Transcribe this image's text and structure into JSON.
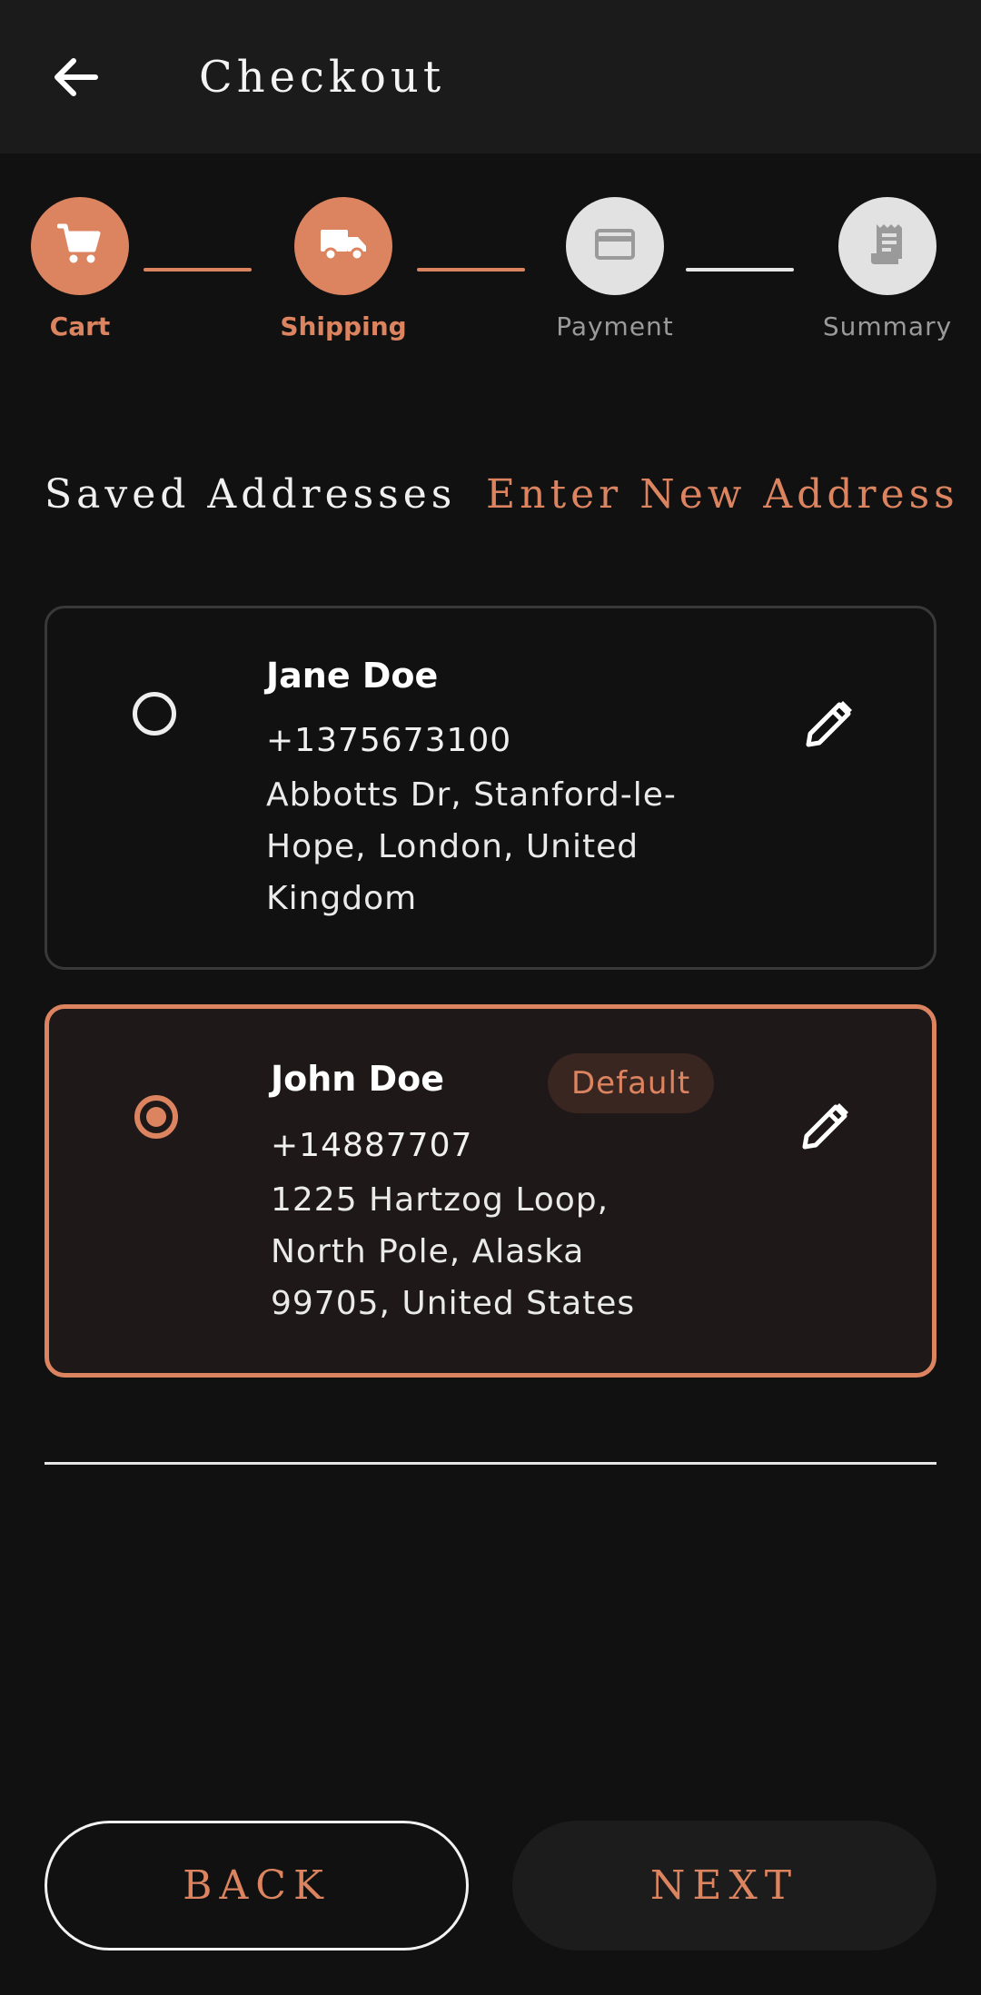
{
  "appbar": {
    "title": "Checkout",
    "back_icon": "arrow-left-icon"
  },
  "stepper": {
    "steps": [
      {
        "label": "Cart",
        "icon": "cart-icon",
        "state": "completed"
      },
      {
        "label": "Shipping",
        "icon": "truck-icon",
        "state": "current"
      },
      {
        "label": "Payment",
        "icon": "credit-card-icon",
        "state": "upcoming"
      },
      {
        "label": "Summary",
        "icon": "receipt-icon",
        "state": "upcoming"
      }
    ]
  },
  "tabs": {
    "saved": "Saved Addresses",
    "new": "Enter New Address"
  },
  "addresses": [
    {
      "name": "Jane Doe",
      "phone": "+1375673100",
      "address_lines": [
        "Abbotts Dr, Stanford-le-",
        "Hope, London, United",
        "Kingdom"
      ],
      "selected": false,
      "badge": ""
    },
    {
      "name": "John Doe",
      "phone": "+14887707",
      "address_lines": [
        "1225 Hartzog Loop,",
        "North Pole, Alaska",
        "99705, United States"
      ],
      "selected": true,
      "badge": "Default"
    }
  ],
  "buttons": {
    "back": "BACK",
    "next": "NEXT"
  },
  "colors": {
    "accent": "#dc8460",
    "background": "#111111",
    "surface": "#1b1b1b",
    "selected_card": "#1e1918"
  }
}
